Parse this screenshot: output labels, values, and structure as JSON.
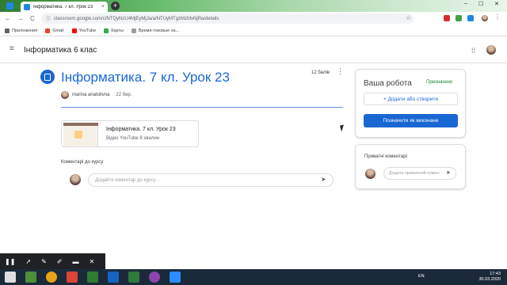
{
  "browser": {
    "tab_title": "Інформатика. 7 кл. Урок 23",
    "tab_close": "×",
    "new_tab": "+",
    "url": "classroom.google.com/c/NTQyNzU4MjEyMjJa/a/NTUyMTgzMzMxNjRa/details",
    "back": "←",
    "forward": "→",
    "reload": "C",
    "lock": "ⓘ",
    "star": "☆",
    "win_min": "–",
    "win_max": "☐",
    "win_close": "✕",
    "bookmarks": [
      {
        "label": "Приложения",
        "color": "#5f6368"
      },
      {
        "label": "Gmail",
        "color": "#ea4335"
      },
      {
        "label": "YouTube",
        "color": "#ff0000"
      },
      {
        "label": "Карты",
        "color": "#34a853"
      },
      {
        "label": "Время-токовые ха...",
        "color": "#9e9e9e"
      }
    ]
  },
  "header": {
    "menu_icon": "≡",
    "course_title": "Інформатика 6 клас",
    "apps_icon": "⋮⋮⋮"
  },
  "assignment": {
    "title": "Інформатика. 7 кл. Урок 23",
    "points": "12 балів",
    "more": "⋮",
    "author": "marina anatolivna",
    "date": "22 бер.",
    "attachment": {
      "title": "Інформатика. 7 кл. Урок 23",
      "meta": "Відео YouTube   8 хвилин"
    },
    "class_comments_label": "Коментарі до курсу",
    "comment_placeholder": "Додайте коментар до курсу...",
    "send": "➤"
  },
  "your_work": {
    "title": "Ваша робота",
    "status": "Призначено",
    "add_button": "+  Додати або створити",
    "done_button": "Позначити як виконане"
  },
  "private_comments": {
    "title": "Приватні коментарі",
    "placeholder": "Додати приватний комен",
    "send": "➤"
  },
  "draw_toolbar": {
    "pause": "❚❚",
    "pointer": "➚",
    "pen": "✎",
    "marker": "✐",
    "camera": "▬",
    "close": "✕"
  },
  "taskbar": {
    "lang": "EN",
    "time": "17:43",
    "date": "30.03.2020",
    "apps": [
      "#ffffff",
      "#4e8f3a",
      "#e8a317",
      "#db4437",
      "#2e7d32",
      "#1565c0",
      "#2f7a3b",
      "#8e44ad",
      "#2d8cff"
    ]
  },
  "colors": {
    "accent": "#1967d2",
    "status_green": "#188038"
  }
}
